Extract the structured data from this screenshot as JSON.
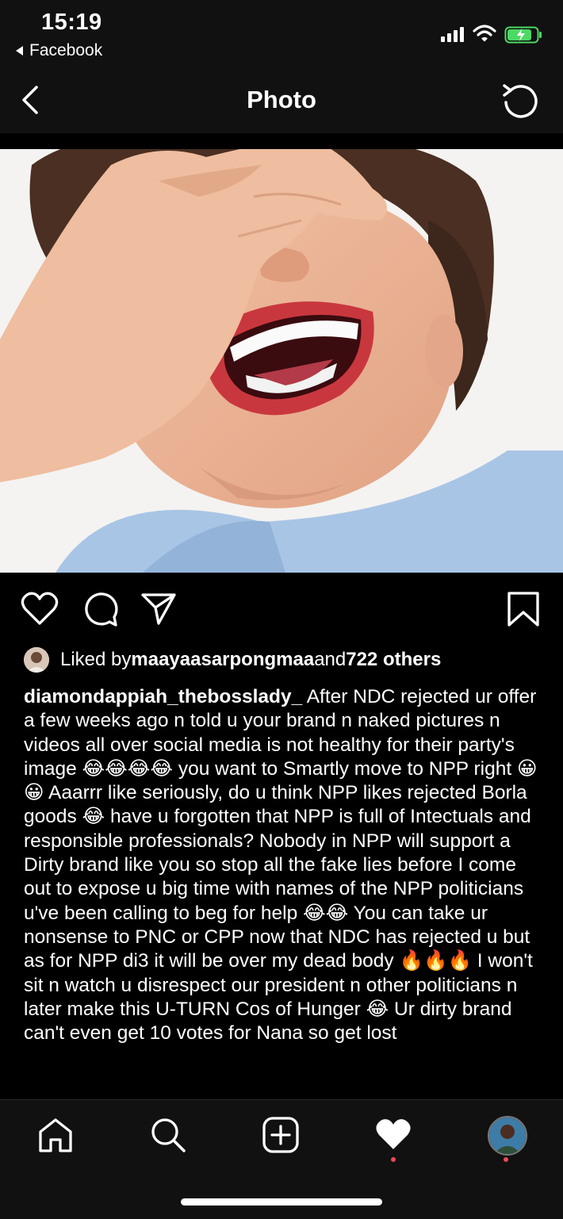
{
  "status_bar": {
    "time": "15:19",
    "back_app": "Facebook",
    "battery_color": "#4cd964"
  },
  "nav": {
    "title": "Photo"
  },
  "post": {
    "liked_prefix": "Liked by ",
    "liked_user": "maayaasarpongmaa",
    "liked_middle": " and ",
    "liked_count": "722 others",
    "caption_user": "diamondappiah_thebosslady_",
    "caption_text": " After NDC rejected ur offer a few weeks ago n told u your brand n naked pictures n videos all over social media is not healthy for their party's image 😂😂😂😂 you want to Smartly move to NPP right 😀😀 Aaarrr like seriously, do u think NPP likes rejected Borla goods 😂 have u forgotten that NPP is full of Intectuals and responsible professionals? Nobody in NPP will support a Dirty brand like you so stop all the fake lies before I come out to expose u big time with names of the NPP politicians u've been calling to beg for help 😂😂 You can take ur nonsense to PNC or CPP now that NDC has rejected u but as for NPP di3 it will be over my dead body 🔥🔥🔥 I won't sit n watch u disrespect our president n other politicians n later make this U-TURN Cos of Hunger 😂 Ur dirty brand can't even get 10 votes for Nana so get lost"
  },
  "icons": {
    "like": "heart-outline-icon",
    "comment": "comment-bubble-icon",
    "share": "paper-plane-icon",
    "save": "bookmark-icon",
    "tabs": [
      "home-icon",
      "search-icon",
      "new-post-icon",
      "activity-heart-icon",
      "profile-avatar"
    ]
  },
  "colors": {
    "background": "#000000",
    "notification_dot": "#ed4956"
  }
}
